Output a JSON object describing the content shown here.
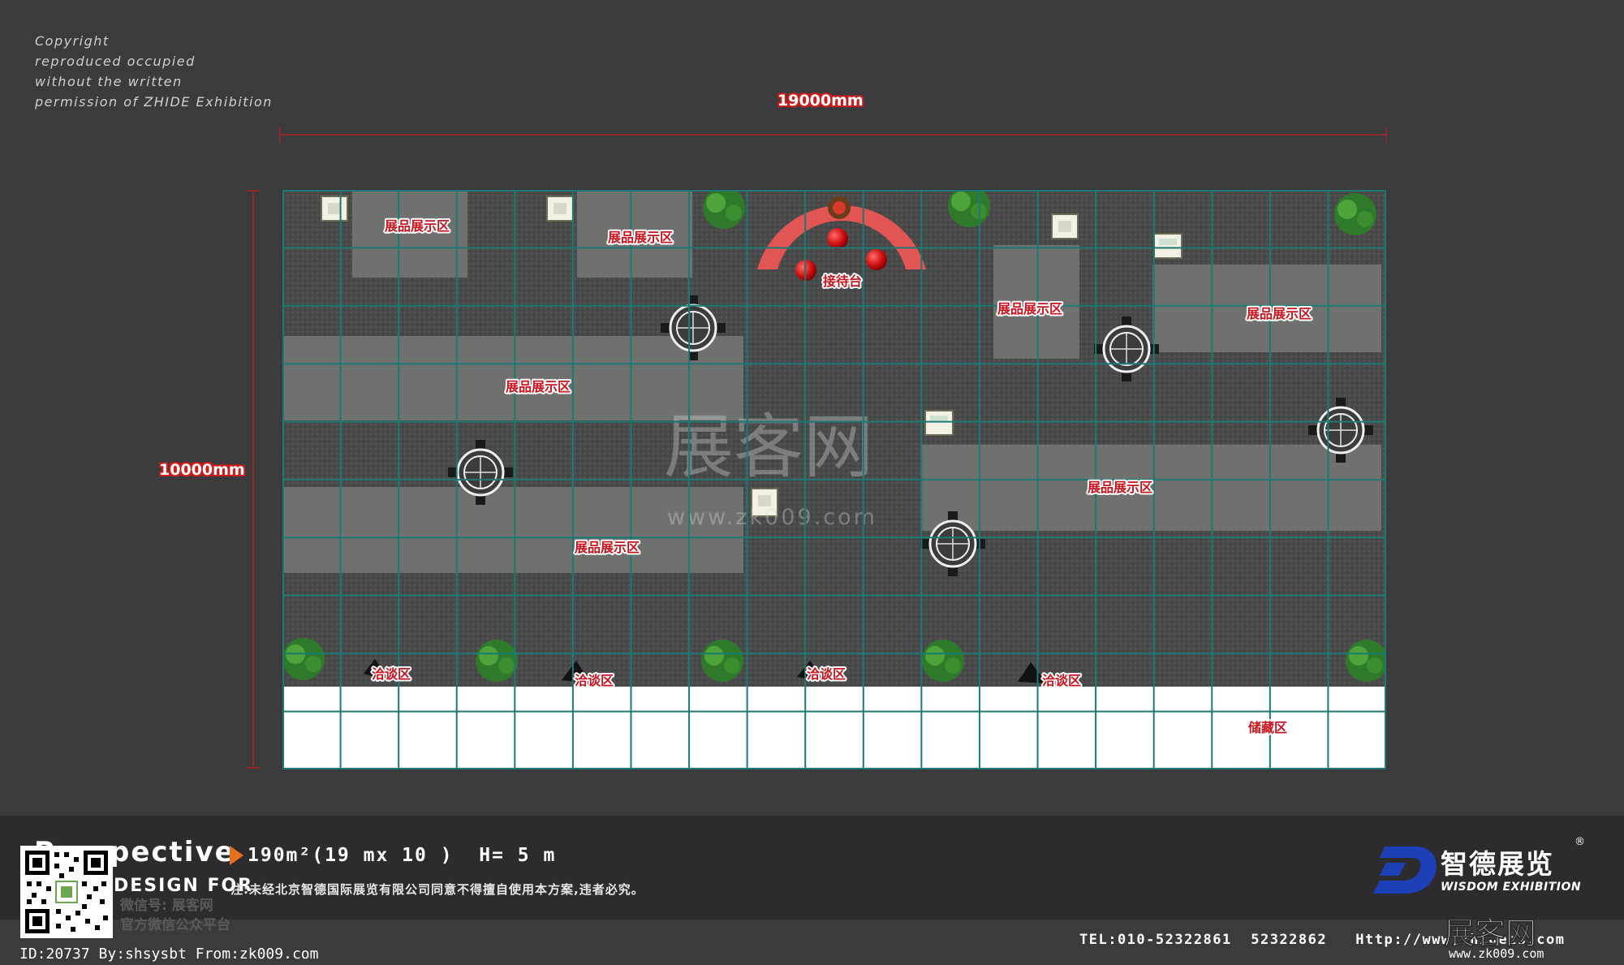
{
  "copyright": {
    "lines": [
      "Copyright",
      "reproduced occupied",
      "without the written",
      "permission of ZHIDE Exhibition"
    ]
  },
  "dimensions": {
    "width_label": "19000mm",
    "height_label": "10000mm"
  },
  "zones": {
    "display_label": "展品展示区",
    "reception_label": "接待台",
    "negotiation_label": "洽谈区",
    "storage_label": "储藏区"
  },
  "watermark": {
    "main": "展客网",
    "url": "www.zk009.com"
  },
  "footer": {
    "perspective": "Perspective",
    "spec": "190m²(19 mx 10 )  H= 5 m",
    "design_for": "DESIGN FOR",
    "notice": "注:未经北京智德国际展览有限公司同意不得擅自使用本方案,违者必究。",
    "wechat_line1": "微信号: 展客网",
    "wechat_line2": "官方微信公众平台",
    "brand_cn": "智德展览",
    "brand_en": "WISDOM EXHIBITION",
    "reg_mark": "®",
    "contact": "TEL:010-52322861  52322862   Http://www.zhidezs.com",
    "site_logo": "展客网",
    "site_url": "www.zk009.com",
    "id_line": "ID:20737 By:shsysbt From:zk009.com"
  },
  "colors": {
    "background": "#3b3b3d",
    "carpet": "#4b4b4b",
    "display_platform": "#6f716f",
    "grid": "#1c7a72",
    "label_red": "#c8141e",
    "reception_red": "#e25555",
    "plant_green": "#2f7a2a",
    "storage": "#ffffff",
    "brand_blue": "#1d3fb8"
  }
}
